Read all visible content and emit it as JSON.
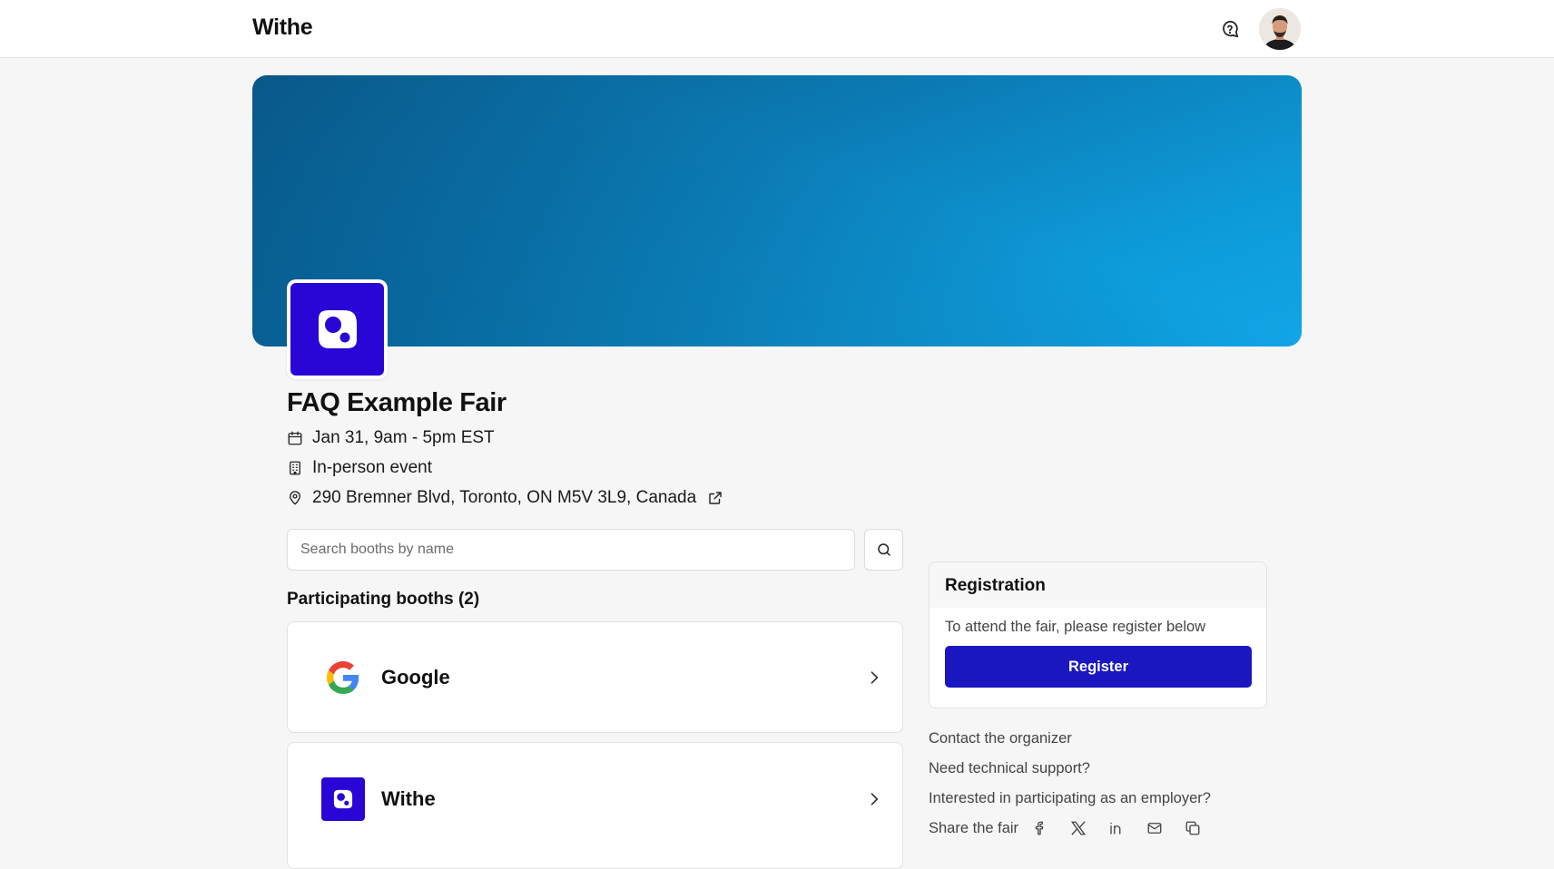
{
  "header": {
    "brand": "Withe",
    "icons": {
      "chat": "chat-help-icon",
      "avatar": "user-avatar"
    }
  },
  "fair": {
    "title": "FAQ Example Fair",
    "date": "Jan 31, 9am - 5pm EST",
    "format": "In-person event",
    "address": "290 Bremner Blvd, Toronto, ON M5V 3L9, Canada",
    "logo_color": "#2a06d6",
    "banner_colors": [
      "#0a5e8f",
      "#10a6e8"
    ]
  },
  "search": {
    "placeholder": "Search booths by name",
    "value": ""
  },
  "booths": {
    "heading": "Participating booths (2)",
    "items": [
      {
        "name": "Google",
        "logo": "google-logo"
      },
      {
        "name": "Withe",
        "logo": "withe-logo"
      }
    ]
  },
  "registration": {
    "title": "Registration",
    "description": "To attend the fair, please register below",
    "button_label": "Register",
    "button_color": "#1a17c0"
  },
  "links": {
    "contact": "Contact the organizer",
    "support": "Need technical support?",
    "employer": "Interested in participating as an employer?",
    "share_label": "Share the fair",
    "share_icons": [
      "facebook-icon",
      "x-icon",
      "linkedin-icon",
      "mail-icon",
      "copy-icon"
    ]
  }
}
